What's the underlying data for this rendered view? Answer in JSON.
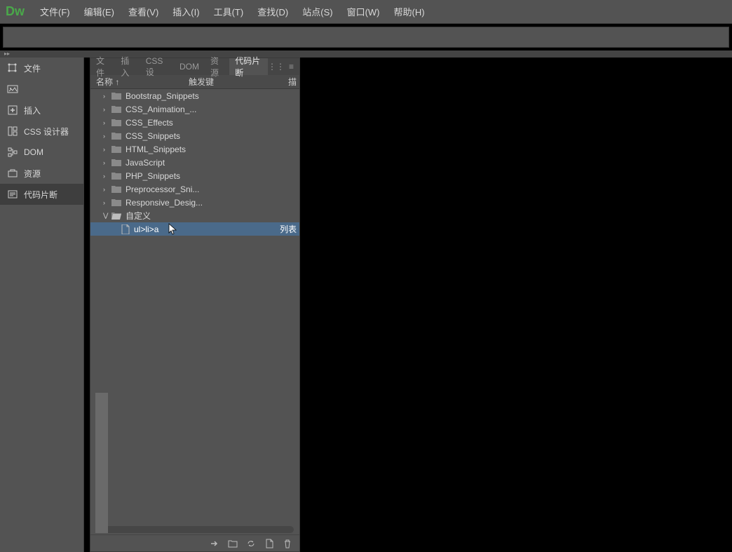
{
  "logo": "Dw",
  "menubar": [
    {
      "label": "文件(F)"
    },
    {
      "label": "编辑(E)"
    },
    {
      "label": "查看(V)"
    },
    {
      "label": "插入(I)"
    },
    {
      "label": "工具(T)"
    },
    {
      "label": "查找(D)"
    },
    {
      "label": "站点(S)"
    },
    {
      "label": "窗口(W)"
    },
    {
      "label": "帮助(H)"
    }
  ],
  "sidebar": {
    "items": [
      {
        "label": "文件",
        "icon": "files"
      },
      {
        "label": "",
        "icon": "image"
      },
      {
        "label": "插入",
        "icon": "insert"
      },
      {
        "label": "CSS 设计器",
        "icon": "cssdes"
      },
      {
        "label": "DOM",
        "icon": "dom"
      },
      {
        "label": "资源",
        "icon": "assets"
      },
      {
        "label": "代码片断",
        "icon": "snippets",
        "active": true
      }
    ]
  },
  "panel": {
    "tabs": [
      {
        "label": "文件"
      },
      {
        "label": "插入"
      },
      {
        "label": "CSS 设"
      },
      {
        "label": "DOM"
      },
      {
        "label": "资源"
      },
      {
        "label": "代码片断",
        "active": true
      }
    ],
    "columns": {
      "name": "名称 ↑",
      "trigger": "触发键",
      "desc": "描"
    },
    "tree": [
      {
        "type": "folder",
        "label": "Bootstrap_Snippets",
        "expanded": false
      },
      {
        "type": "folder",
        "label": "CSS_Animation_...",
        "expanded": false
      },
      {
        "type": "folder",
        "label": "CSS_Effects",
        "expanded": false
      },
      {
        "type": "folder",
        "label": "CSS_Snippets",
        "expanded": false
      },
      {
        "type": "folder",
        "label": "HTML_Snippets",
        "expanded": false
      },
      {
        "type": "folder",
        "label": "JavaScript",
        "expanded": false
      },
      {
        "type": "folder",
        "label": "PHP_Snippets",
        "expanded": false
      },
      {
        "type": "folder",
        "label": "Preprocessor_Sni...",
        "expanded": false
      },
      {
        "type": "folder",
        "label": "Responsive_Desig...",
        "expanded": false
      },
      {
        "type": "folder",
        "label": "自定义",
        "expanded": true,
        "open": true,
        "children": [
          {
            "type": "file",
            "label": "ul>li>a",
            "right": "列表",
            "selected": true
          }
        ]
      }
    ]
  }
}
